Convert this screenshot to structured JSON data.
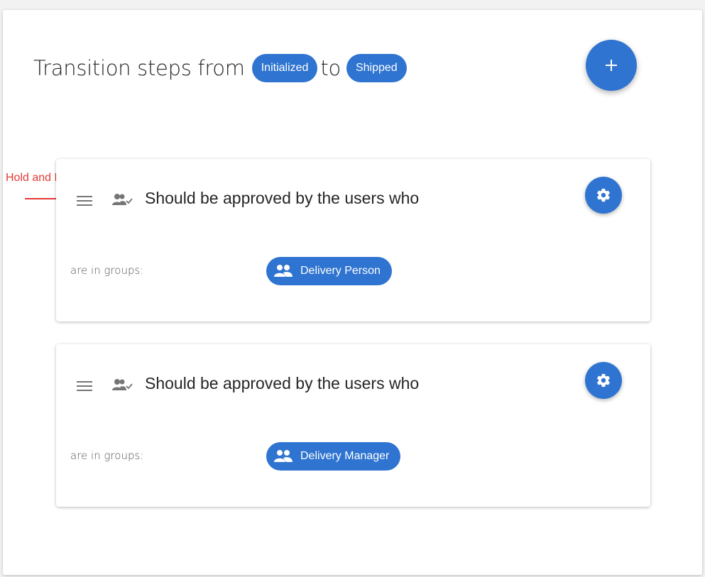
{
  "header": {
    "prefix": "Transition steps from",
    "from_status": "Initialized",
    "joiner": "to",
    "to_status": "Shipped"
  },
  "add_button": {
    "icon": "plus-icon"
  },
  "annotation": {
    "text": "Hold and Drag",
    "color": "#e53935"
  },
  "accent_color": "#2f74d0",
  "steps": [
    {
      "title": "Should be approved by the users who",
      "condition_label": "are in groups:",
      "group": "Delivery Person"
    },
    {
      "title": "Should be approved by the users who",
      "condition_label": "are in groups:",
      "group": "Delivery Manager"
    }
  ]
}
